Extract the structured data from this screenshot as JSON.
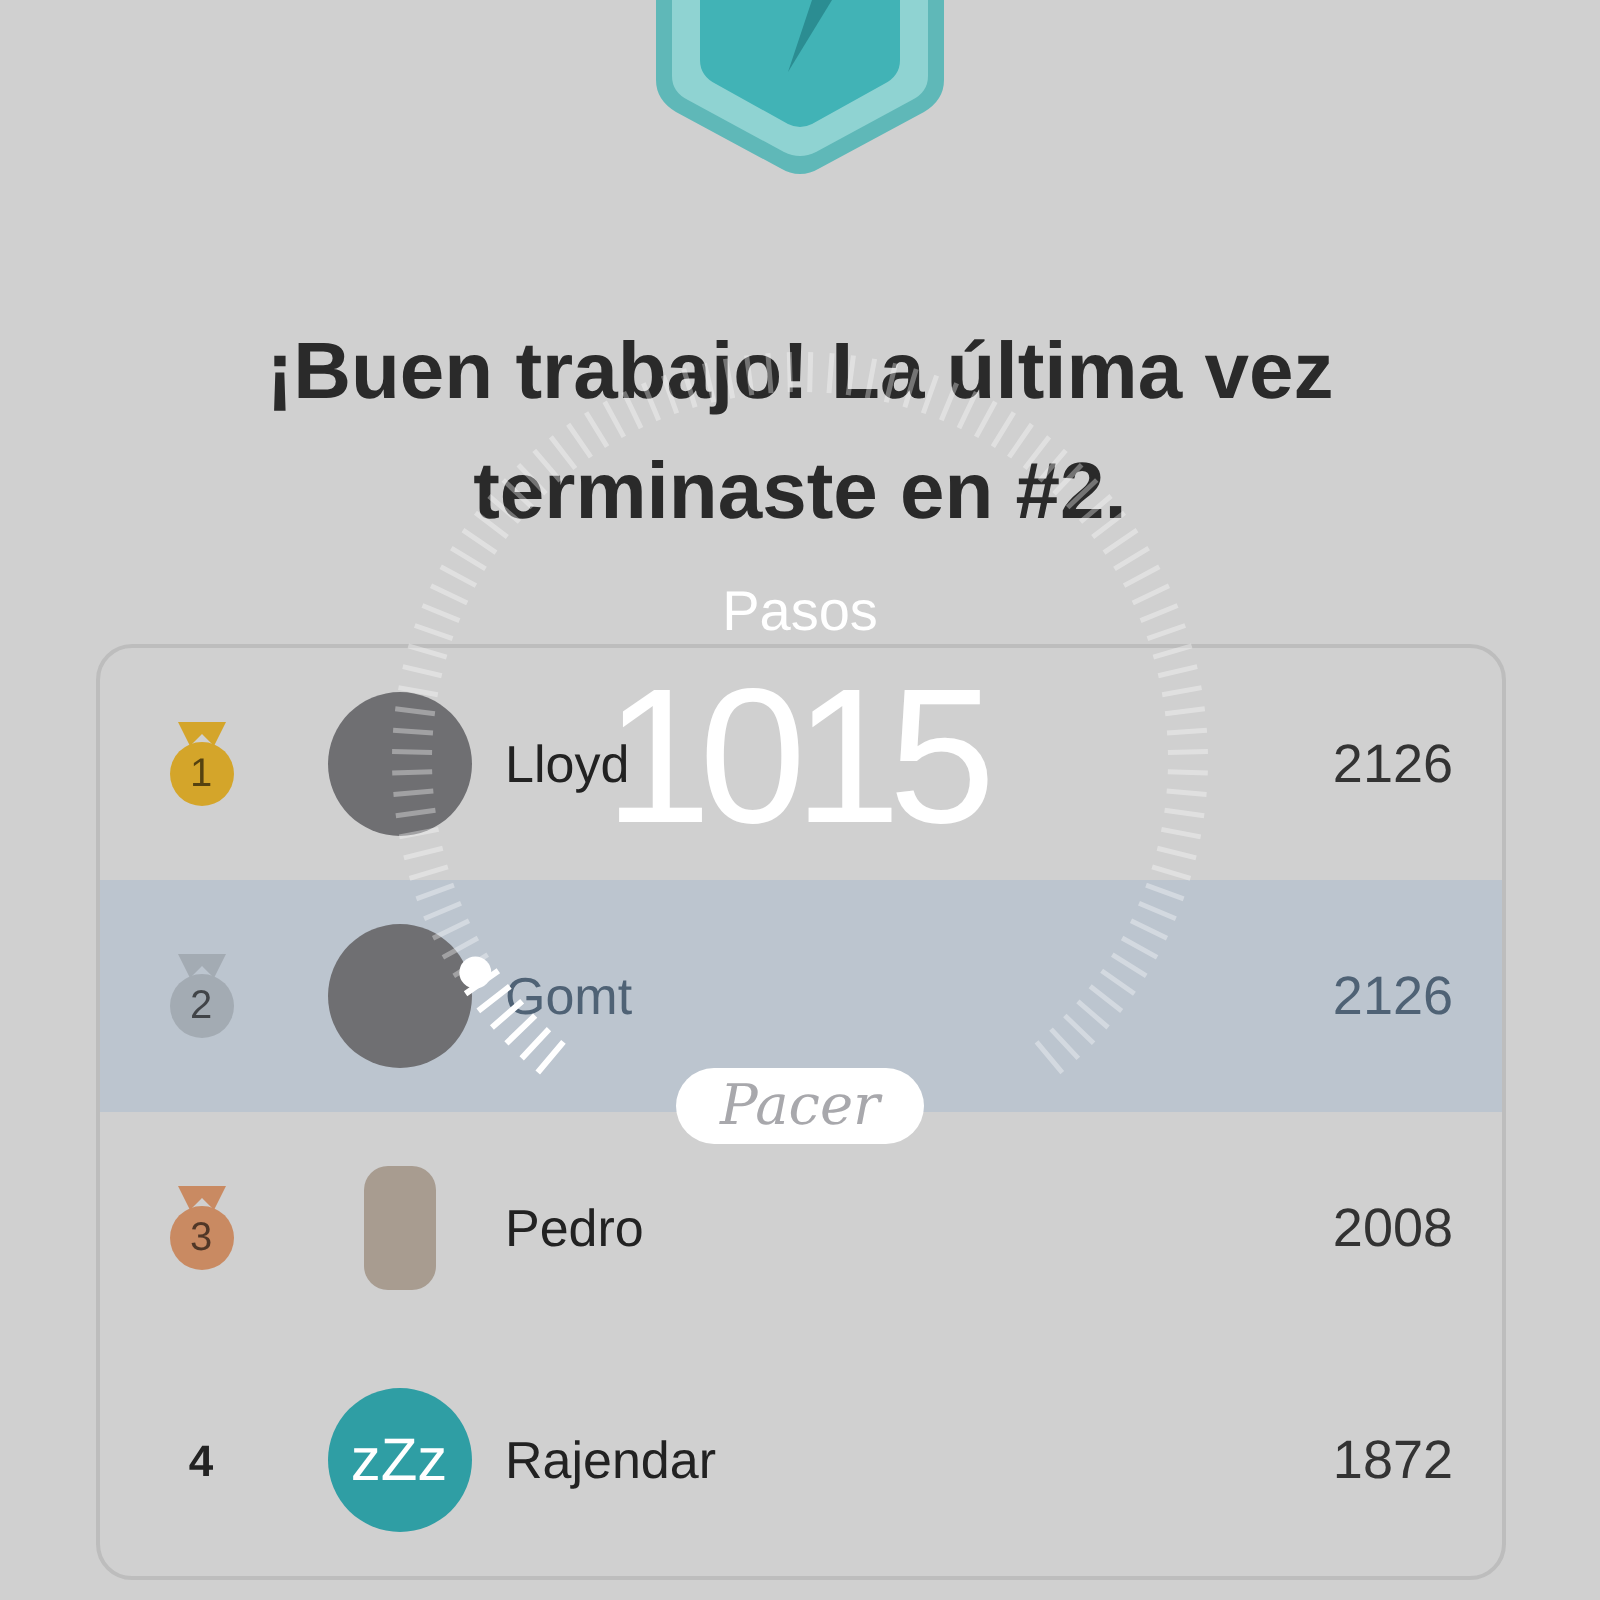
{
  "title": "¡Buen trabajo! La última vez terminaste en #2.",
  "leaderboard": [
    {
      "rank": "1",
      "kind": "medal",
      "color": "#d4a52a",
      "avatar": {
        "kind": "photo"
      },
      "name": "Lloyd",
      "steps": "2126",
      "selected": false
    },
    {
      "rank": "2",
      "kind": "medal",
      "color": "#a3abb3",
      "avatar": {
        "kind": "photo"
      },
      "name": "Gomt",
      "steps": "2126",
      "selected": true
    },
    {
      "rank": "3",
      "kind": "medal",
      "color": "#c98a62",
      "avatar": {
        "kind": "sticker"
      },
      "name": "Pedro",
      "steps": "2008",
      "selected": false
    },
    {
      "rank": "4",
      "kind": "plain",
      "avatar": {
        "kind": "initials",
        "text": "zZz"
      },
      "name": "Rajendar",
      "steps": "1872",
      "selected": false
    }
  ],
  "overlay": {
    "label": "Pasos",
    "value": "1015",
    "level": 0.06,
    "brand": "Pacer"
  }
}
